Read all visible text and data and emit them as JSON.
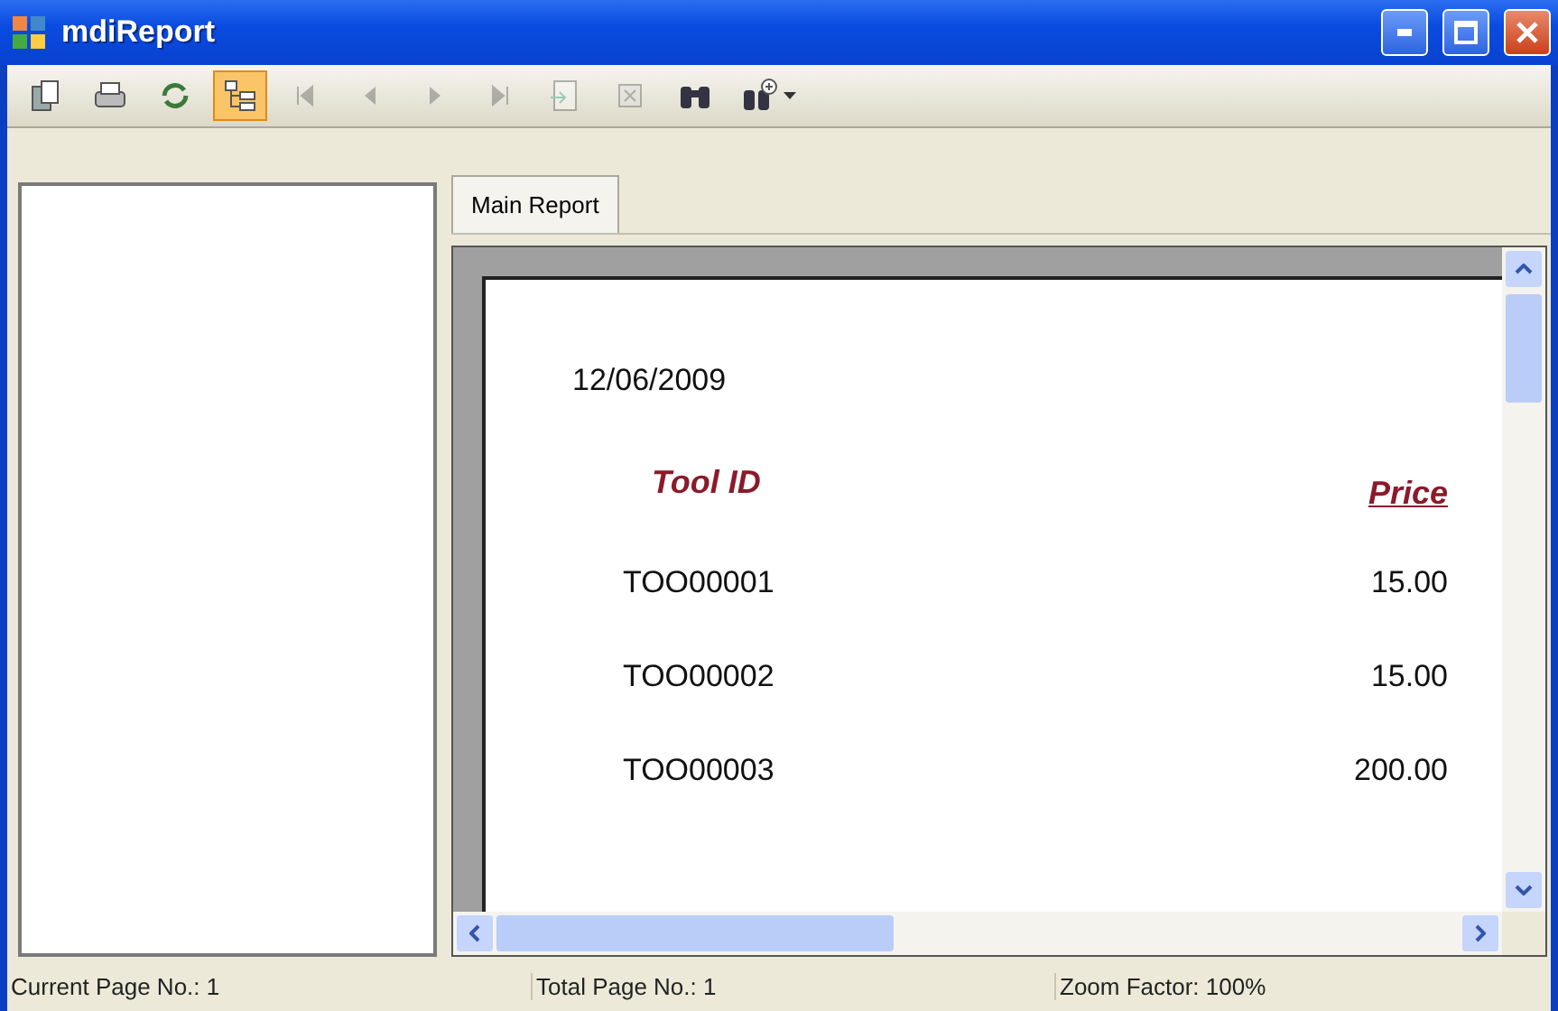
{
  "window": {
    "title": "mdiReport"
  },
  "toolbar": [
    {
      "kind": "export",
      "disabled": false,
      "selected": false
    },
    {
      "kind": "print",
      "disabled": false,
      "selected": false
    },
    {
      "kind": "refresh",
      "disabled": false,
      "selected": false
    },
    {
      "kind": "tree",
      "disabled": false,
      "selected": true
    },
    {
      "kind": "first",
      "disabled": true,
      "selected": false
    },
    {
      "kind": "prev",
      "disabled": true,
      "selected": false
    },
    {
      "kind": "next",
      "disabled": true,
      "selected": false
    },
    {
      "kind": "last",
      "disabled": true,
      "selected": false
    },
    {
      "kind": "goto",
      "disabled": true,
      "selected": false
    },
    {
      "kind": "stop",
      "disabled": true,
      "selected": false
    },
    {
      "kind": "find",
      "disabled": false,
      "selected": false
    },
    {
      "kind": "zoom",
      "disabled": false,
      "selected": false
    }
  ],
  "tabs": [
    {
      "label": "Main Report",
      "selected": true
    }
  ],
  "report": {
    "date": "12/06/2009",
    "columns": [
      "Tool ID",
      "Price"
    ],
    "rows": [
      [
        "TOO00001",
        "15.00"
      ],
      [
        "TOO00002",
        "15.00"
      ],
      [
        "TOO00003",
        "200.00"
      ]
    ]
  },
  "status_bar": [
    "Current Page No.: 1",
    "Total Page No.: 1",
    "Zoom Factor: 100%"
  ]
}
